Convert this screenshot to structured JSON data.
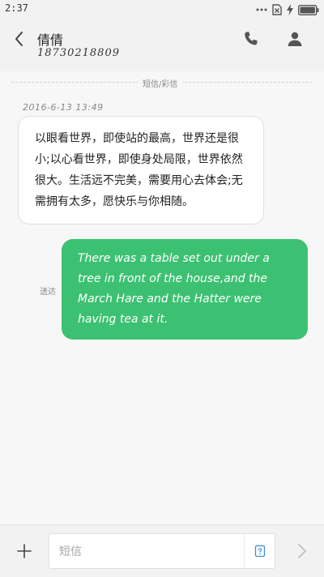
{
  "status_bar": {
    "time": "2:37",
    "icons": [
      "dots-icon",
      "sim-error-icon",
      "charging-icon",
      "battery-icon"
    ]
  },
  "header": {
    "contact_name": "倩倩",
    "contact_number": "18730218809",
    "icons": {
      "back": "chevron-left-icon",
      "call": "phone-icon",
      "profile": "person-icon"
    }
  },
  "thread": {
    "channel_label": "短信/彩信",
    "timestamp": "2016-6-13 13:49",
    "messages": [
      {
        "direction": "incoming",
        "text": "以眼看世界，即使站的最高，世界还是很小;以心看世界，即使身处局限，世界依然很大。生活远不完美，需要用心去体会;无需拥有太多，愿快乐与你相随。"
      },
      {
        "direction": "outgoing",
        "text": "There was a table set out under a tree in front of the house,and the March Hare and the Hatter were having tea at it.",
        "status": "送达"
      }
    ]
  },
  "composer": {
    "placeholder": "短信",
    "icons": {
      "add": "plus-icon",
      "template": "template-icon",
      "send": "send-arrow-icon"
    }
  },
  "colors": {
    "outgoing_bubble": "#3cc172",
    "incoming_bubble": "#ffffff",
    "background": "#f7f7f7",
    "bar": "#f2f2f2"
  }
}
